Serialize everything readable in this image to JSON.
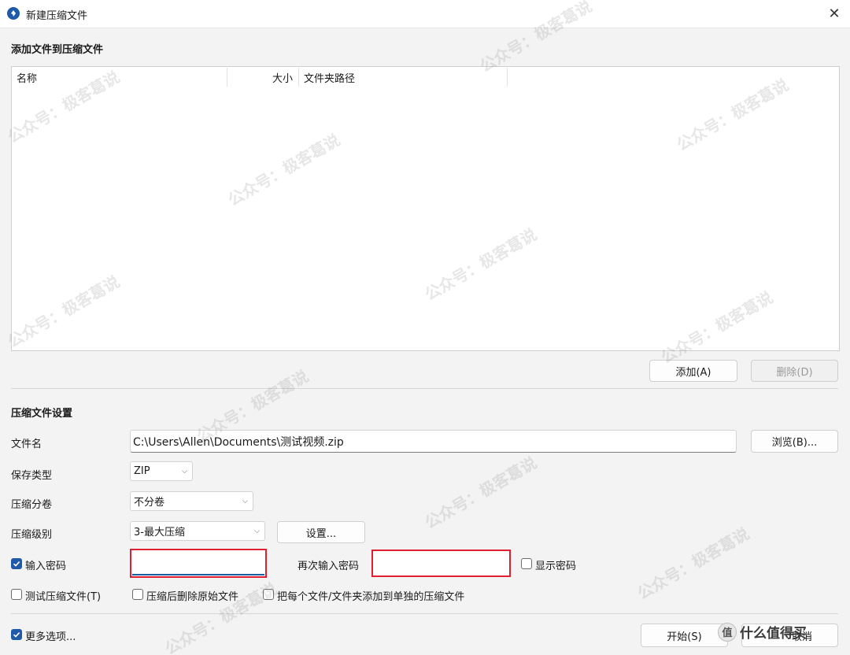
{
  "window": {
    "title": "新建压缩文件"
  },
  "add_section": {
    "title": "添加文件到压缩文件"
  },
  "file_table": {
    "columns": [
      "名称",
      "大小",
      "文件夹路径"
    ]
  },
  "file_buttons": {
    "add": "添加(A)",
    "delete": "删除(D)"
  },
  "settings": {
    "title": "压缩文件设置",
    "filename_label": "文件名",
    "filename_value": "C:\\Users\\Allen\\Documents\\测试视频.zip",
    "browse": "浏览(B)...",
    "save_type_label": "保存类型",
    "save_type_value": "ZIP",
    "split_label": "压缩分卷",
    "split_value": "不分卷",
    "level_label": "压缩级别",
    "level_value": "3-最大压缩",
    "level_settings": "设置...",
    "password_label": "输入密码",
    "password_checked": true,
    "password_value": "",
    "repeat_password_label": "再次输入密码",
    "repeat_password_value": "",
    "show_password_label": "显示密码",
    "show_password_checked": false,
    "options": [
      {
        "label": "测试压缩文件(T)",
        "checked": false
      },
      {
        "label": "压缩后删除原始文件",
        "checked": false
      },
      {
        "label": "把每个文件/文件夹添加到单独的压缩文件",
        "checked": false
      }
    ]
  },
  "footer": {
    "more_options": "更多选项...",
    "more_options_checked": true,
    "start": "开始(S)",
    "cancel": "取消"
  },
  "watermark": {
    "text": "公众号：极客葛说"
  },
  "brand": {
    "badge": "值",
    "text": "什么值得买"
  },
  "icons": {
    "app": "app-logo-icon",
    "close": "close-icon",
    "chevron": "chevron-down-icon",
    "check": "checkmark-icon"
  },
  "colors": {
    "accent": "#1e5aa8",
    "highlight_border": "#e02030"
  }
}
